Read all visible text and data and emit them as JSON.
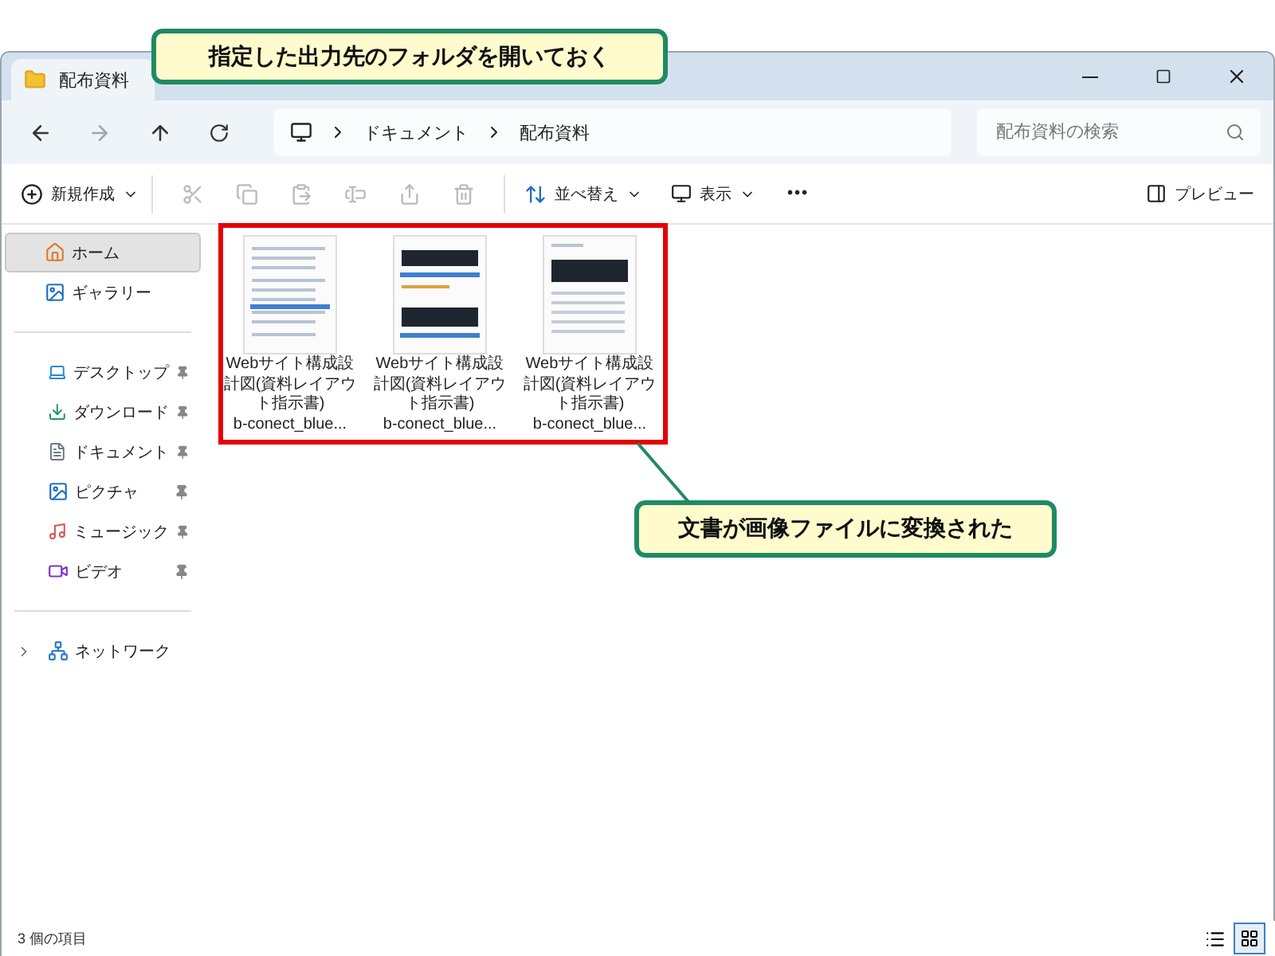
{
  "window": {
    "tabs": [
      {
        "label": "配布資料",
        "selected": true
      }
    ]
  },
  "address_bar": {
    "breadcrumb": [
      "ドキュメント",
      "配布資料"
    ]
  },
  "search": {
    "placeholder": "配布資料の検索"
  },
  "toolbar": {
    "new_label": "新規作成",
    "icon_actions": [
      {
        "disabled": true
      },
      {
        "disabled": true
      },
      {
        "disabled": true
      },
      {
        "disabled": true
      },
      {
        "disabled": true
      },
      {
        "disabled": true
      }
    ],
    "sort_label": "並べ替え",
    "view_label": "表示",
    "more_label": "•••",
    "preview_label": "プレビュー"
  },
  "sidebar": {
    "groups": [
      {
        "items": [
          {
            "label": "ホーム",
            "selected": true,
            "pinned": false
          },
          {
            "label": "ギャラリー",
            "selected": false,
            "pinned": false
          }
        ]
      },
      {
        "items": [
          {
            "label": "デスクトップ",
            "selected": false,
            "pinned": true
          },
          {
            "label": "ダウンロード",
            "selected": false,
            "pinned": true
          },
          {
            "label": "ドキュメント",
            "selected": false,
            "pinned": true
          },
          {
            "label": "ピクチャ",
            "selected": false,
            "pinned": true
          },
          {
            "label": "ミュージック",
            "selected": false,
            "pinned": true
          },
          {
            "label": "ビデオ",
            "selected": false,
            "pinned": true
          }
        ]
      },
      {
        "items": [
          {
            "label": "ネットワーク",
            "selected": false,
            "pinned": false,
            "expandable": true
          }
        ]
      }
    ]
  },
  "files": [
    {
      "title": "Webサイト構成設計図(資料レイアウト指示書)",
      "name_end": "b-conect_blue..."
    },
    {
      "title": "Webサイト構成設計図(資料レイアウト指示書)",
      "name_end": "b-conect_blue..."
    },
    {
      "title": "Webサイト構成設計図(資料レイアウト指示書)",
      "name_end": "b-conect_blue..."
    }
  ],
  "status_bar": {
    "item_count": "3 個の項目",
    "view_modes": [
      {
        "selected": false
      },
      {
        "selected": true
      }
    ]
  },
  "annotations": [
    {
      "text": "指定した出力先のフォルダを開いておく"
    },
    {
      "text": "文書が画像ファイルに変換された"
    }
  ]
}
